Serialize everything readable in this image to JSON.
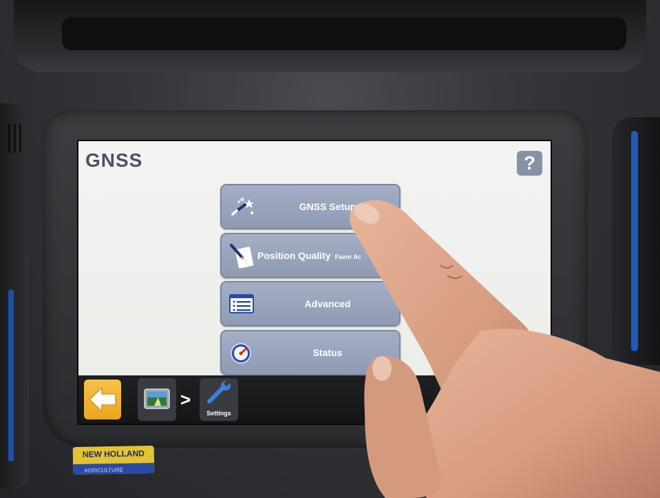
{
  "app": {
    "page_title": "GNSS",
    "help_label": "?"
  },
  "menu": {
    "items": [
      {
        "label": "GNSS Setup",
        "icon": "wand-icon"
      },
      {
        "label": "Position Quality",
        "sublabel": "Favor Ac",
        "icon": "document-pen-icon"
      },
      {
        "label": "Advanced",
        "icon": "list-icon"
      },
      {
        "label": "Status",
        "icon": "gauge-icon"
      }
    ]
  },
  "bottom_bar": {
    "breadcrumb_separator": ">",
    "settings_label": "Settings"
  },
  "device": {
    "brand": "NEW HOLLAND",
    "brand_sub": "AGRICULTURE"
  },
  "colors": {
    "button_fill": "#99a4bc",
    "title_text": "#4a5364",
    "back_button": "#f0b33a",
    "logo_yellow": "#e3c233"
  }
}
